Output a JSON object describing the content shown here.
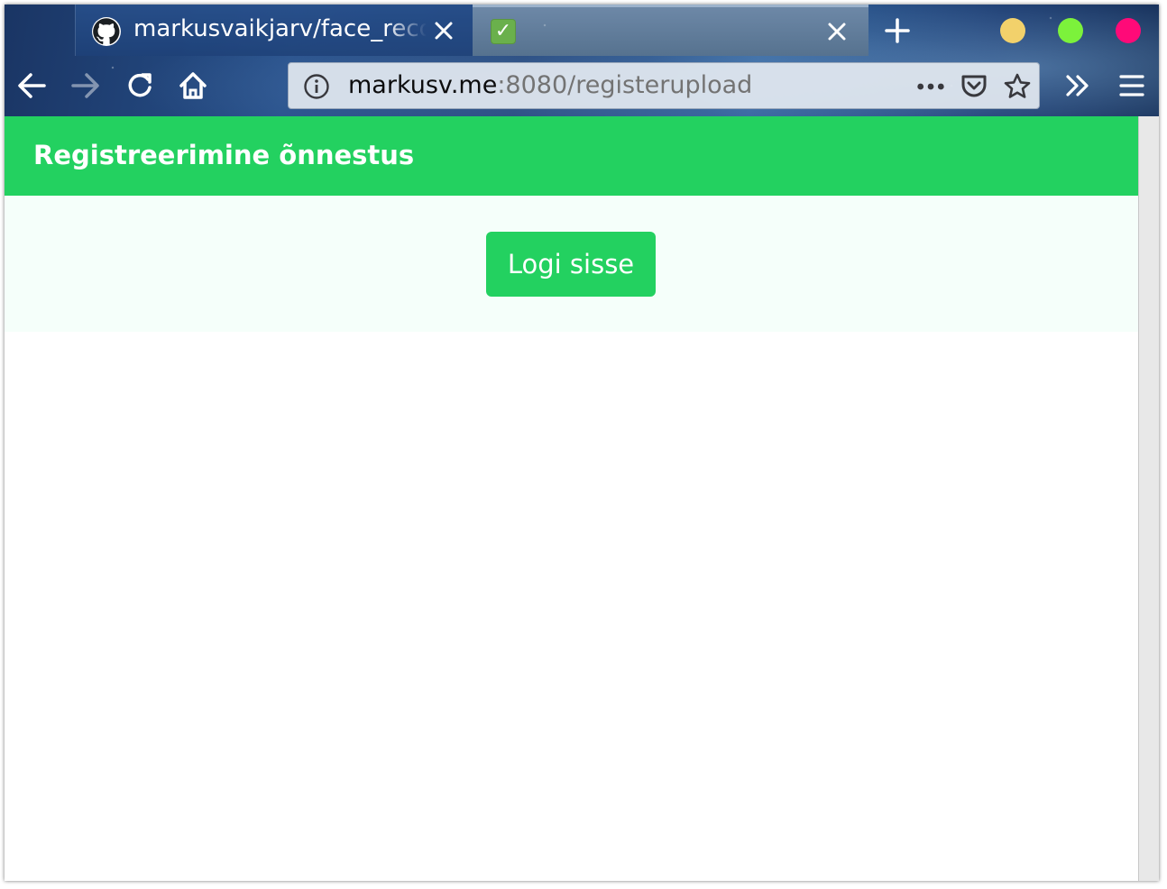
{
  "browser": {
    "tabs": [
      {
        "title": "markusvaikjarv/face_recognition",
        "icon": "github-icon",
        "active": false
      },
      {
        "title": "",
        "icon": "check-mark-icon",
        "active": true
      }
    ],
    "url": {
      "host": "markusv.me",
      "path": ":8080/registerupload"
    },
    "window_controls": {
      "minimize_color": "#f2d16b",
      "maximize_color": "#7cf23b",
      "close_color": "#ff0a78"
    }
  },
  "page": {
    "header": {
      "title": "Registreerimine õnnestus",
      "background": "#23d160"
    },
    "login_button": {
      "label": "Logi sisse"
    },
    "panel_background": "#f5fffa"
  }
}
